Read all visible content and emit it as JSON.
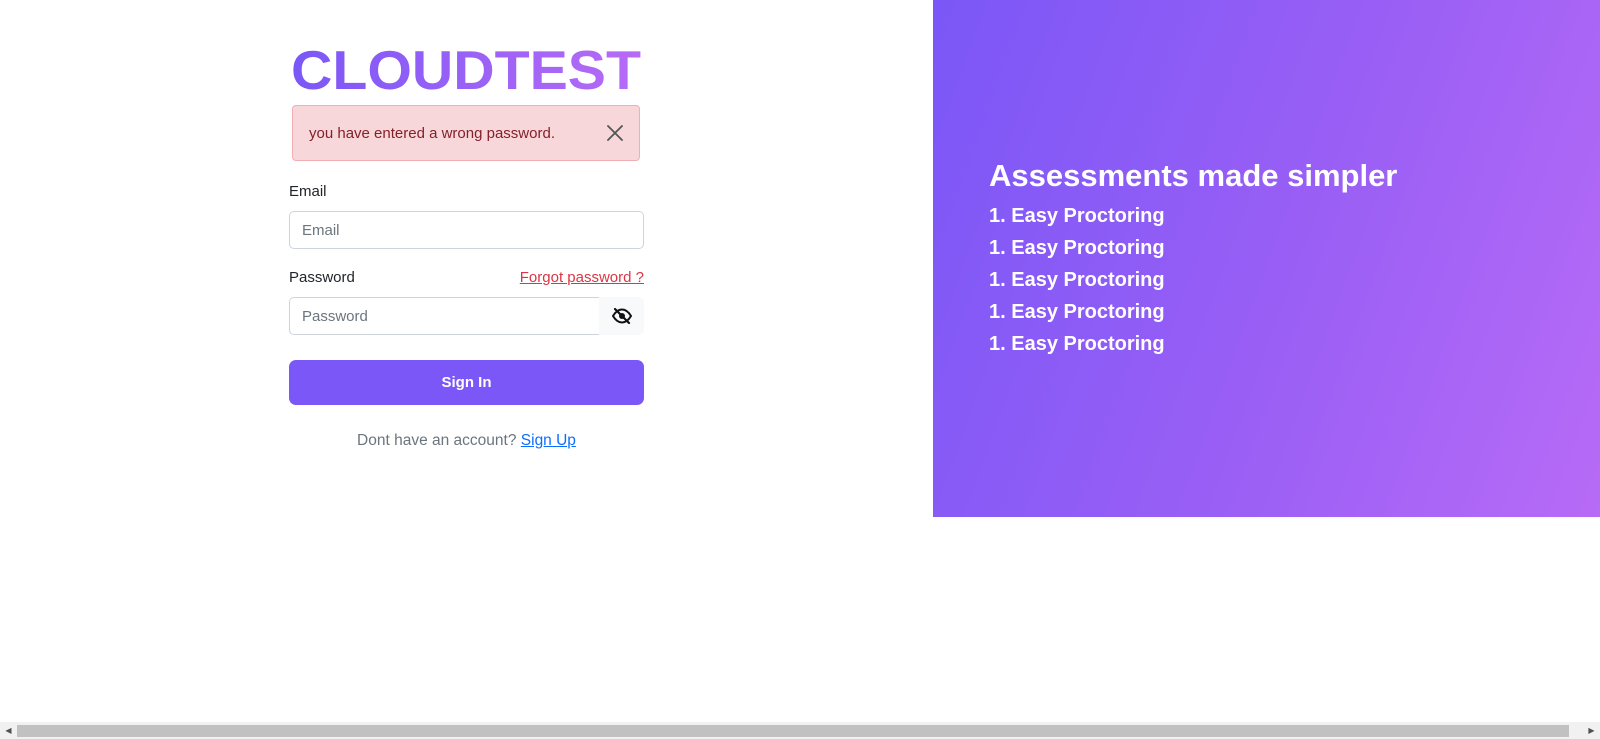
{
  "brand": {
    "logo_text": "CLOUDTEST",
    "gradient_start": "#7b57f7",
    "gradient_end": "#b76bf6"
  },
  "alert": {
    "message": "you have entered a wrong password.",
    "close_icon": "close-icon",
    "background": "#f8d7da",
    "text_color": "#842029"
  },
  "form": {
    "email_label": "Email",
    "email_placeholder": "Email",
    "email_value": "",
    "password_label": "Password",
    "password_placeholder": "Password",
    "password_value": "",
    "forgot_password": "Forgot password ?",
    "toggle_icon": "eye-slash-icon",
    "signin_label": "Sign In",
    "signin_color": "#7b57f7",
    "signup_prompt": "Dont have an account?",
    "signup_link": "Sign Up"
  },
  "promo": {
    "heading": "Assessments made simpler",
    "items": [
      "1. Easy Proctoring",
      "1. Easy Proctoring",
      "1. Easy Proctoring",
      "1. Easy Proctoring",
      "1. Easy Proctoring"
    ]
  },
  "scrollbar": {
    "left_arrow": "◀",
    "right_arrow": "▶"
  }
}
